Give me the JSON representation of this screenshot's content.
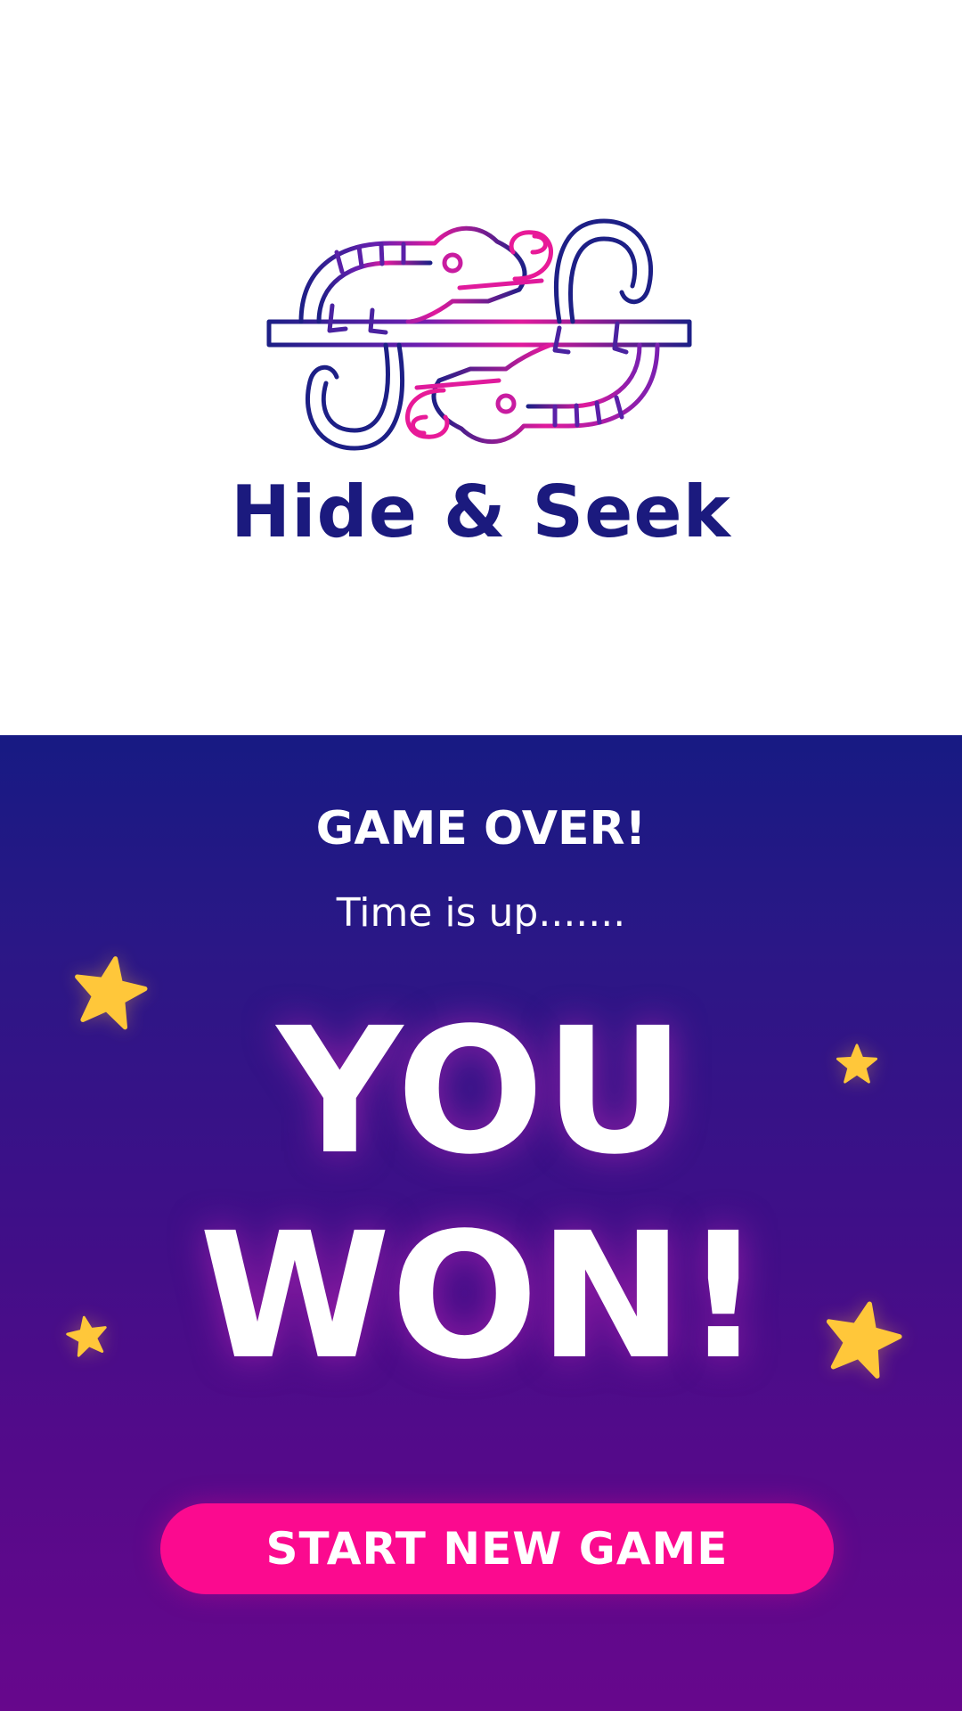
{
  "app": {
    "title": "Hide & Seek",
    "logo_icon": "chameleons-logo-icon"
  },
  "result": {
    "heading": "GAME OVER!",
    "subtext": "Time is up.......",
    "line1": "YOU",
    "line2": "WON!"
  },
  "actions": {
    "start_new_game": "START NEW GAME"
  },
  "decorations": {
    "star_icon": "star-icon",
    "star_color": "#ffc73a"
  },
  "colors": {
    "brand_navy": "#1b1a7e",
    "brand_pink": "#fb0a8f",
    "gradient_top": "#171a83",
    "gradient_bottom": "#67078c"
  }
}
